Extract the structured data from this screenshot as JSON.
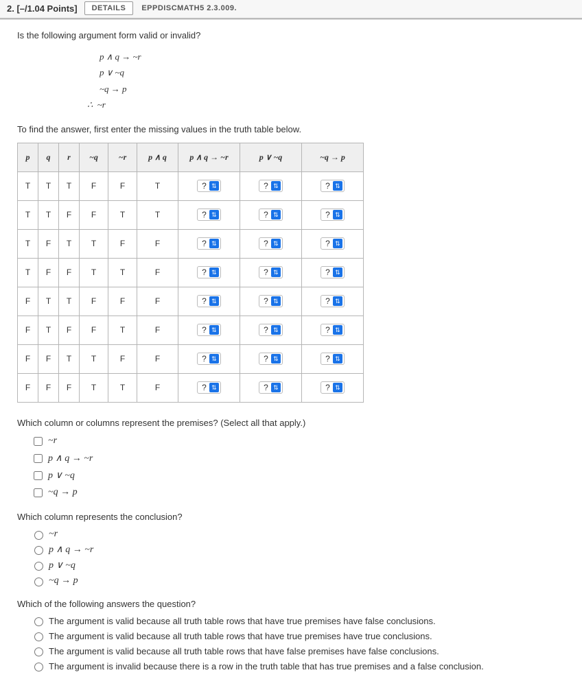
{
  "header": {
    "qnum": "2. [–/1.04 Points]",
    "details": "DETAILS",
    "ref": "EPPDISCMATH5 2.3.009."
  },
  "prompt1": "Is the following argument form valid or invalid?",
  "argument": {
    "l1": "p ∧ q → ~r",
    "l2": "p ∨ ~q",
    "l3": "~q → p",
    "l4": "∴  ~r"
  },
  "prompt2": "To find the answer, first enter the missing values in the truth table below.",
  "thead": {
    "c1": "p",
    "c2": "q",
    "c3": "r",
    "c4": "~q",
    "c5": "~r",
    "c6": "p ∧ q",
    "c7": "p ∧ q → ~r",
    "c8": "p ∨ ~q",
    "c9": "~q → p"
  },
  "rows": [
    {
      "p": "T",
      "q": "T",
      "r": "T",
      "nq": "F",
      "nr": "F",
      "paq": "T"
    },
    {
      "p": "T",
      "q": "T",
      "r": "F",
      "nq": "F",
      "nr": "T",
      "paq": "T"
    },
    {
      "p": "T",
      "q": "F",
      "r": "T",
      "nq": "T",
      "nr": "F",
      "paq": "F"
    },
    {
      "p": "T",
      "q": "F",
      "r": "F",
      "nq": "T",
      "nr": "T",
      "paq": "F"
    },
    {
      "p": "F",
      "q": "T",
      "r": "T",
      "nq": "F",
      "nr": "F",
      "paq": "F"
    },
    {
      "p": "F",
      "q": "T",
      "r": "F",
      "nq": "F",
      "nr": "T",
      "paq": "F"
    },
    {
      "p": "F",
      "q": "F",
      "r": "T",
      "nq": "T",
      "nr": "F",
      "paq": "F"
    },
    {
      "p": "F",
      "q": "F",
      "r": "F",
      "nq": "T",
      "nr": "T",
      "paq": "F"
    }
  ],
  "dropdown_placeholder": "?",
  "q_premises": "Which column or columns represent the premises? (Select all that apply.)",
  "q_conclusion": "Which column represents the conclusion?",
  "q_answer": "Which of the following answers the question?",
  "col_options": {
    "o1": "~r",
    "o2": "p ∧ q → ~r",
    "o3": "p ∨ ~q",
    "o4": "~q → p"
  },
  "answers": {
    "a1": "The argument is valid because all truth table rows that have true premises have false conclusions.",
    "a2": "The argument is valid because all truth table rows that have true premises have true conclusions.",
    "a3": "The argument is valid because all truth table rows that have false premises have false conclusions.",
    "a4": "The argument is invalid because there is a row in the truth table that has true premises and a false conclusion."
  }
}
